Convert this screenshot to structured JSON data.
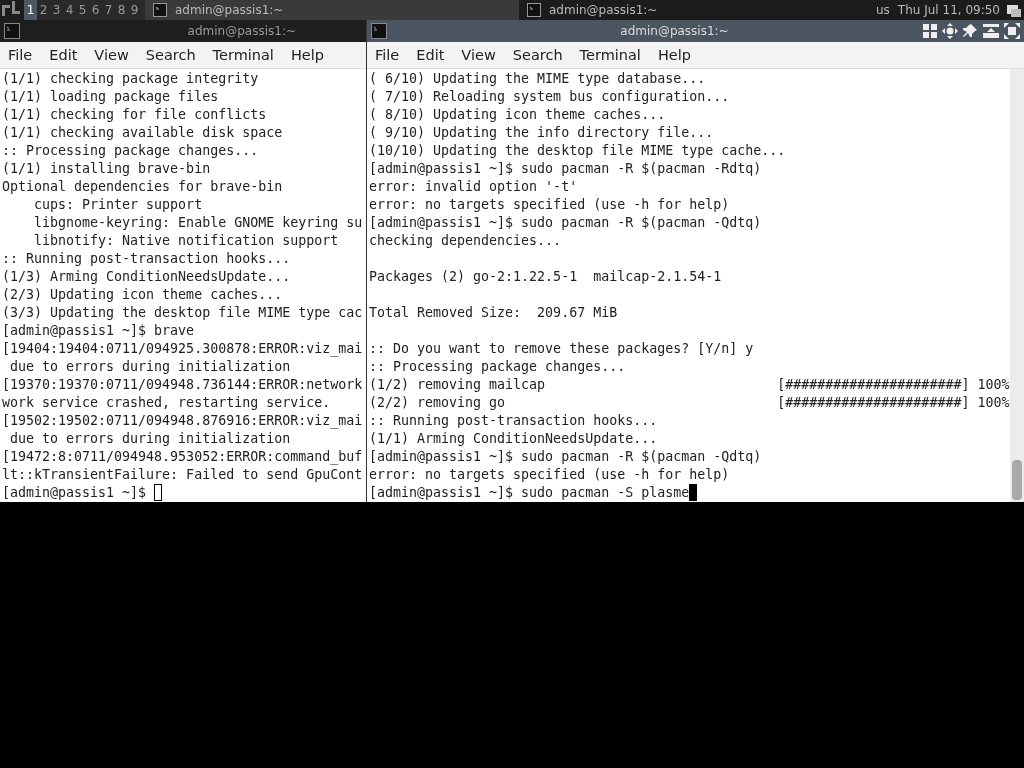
{
  "panel": {
    "workspaces": [
      {
        "label": "1",
        "selected": true
      },
      {
        "label": "2",
        "selected": false
      },
      {
        "label": "3",
        "selected": false
      },
      {
        "label": "4",
        "selected": false
      },
      {
        "label": "5",
        "selected": false
      },
      {
        "label": "6",
        "selected": false
      },
      {
        "label": "7",
        "selected": false
      },
      {
        "label": "8",
        "selected": false
      },
      {
        "label": "9",
        "selected": false
      }
    ],
    "tasks": [
      {
        "title": "admin@passis1:~",
        "selected": true
      },
      {
        "title": "admin@passis1:~",
        "selected": false
      }
    ],
    "keyboard_layout": "us",
    "clock": "Thu Jul 11, 09:50"
  },
  "windows": [
    {
      "title": "admin@passis1:~",
      "focused": false,
      "scrollbar": false,
      "menu": [
        "File",
        "Edit",
        "View",
        "Search",
        "Terminal",
        "Help"
      ],
      "blocks": [
        [
          "(1/1) checking package integrity",
          "(1/1) loading package files",
          "(1/1) checking for file conflicts",
          "(1/1) checking available disk space",
          ":: Processing package changes...",
          "(1/1) installing brave-bin",
          "Optional dependencies for brave-bin",
          "    cups: Printer support",
          "    libgnome-keyring: Enable GNOME keyring su",
          "    libnotify: Native notification support",
          ":: Running post-transaction hooks...",
          "(1/3) Arming ConditionNeedsUpdate...",
          "(2/3) Updating icon theme caches...",
          "(3/3) Updating the desktop file MIME type cac",
          "[admin@passis1 ~]$ brave",
          "[19404:19404:0711/094925.300878:ERROR:viz_mai",
          " due to errors during initialization",
          "[19370:19370:0711/094948.736144:ERROR:network",
          "work service crashed, restarting service.",
          "[19502:19502:0711/094948.876916:ERROR:viz_mai",
          " due to errors during initialization",
          "[19472:8:0711/094948.953052:ERROR:command_buf",
          "lt::kTransientFailure: Failed to send GpuCont",
          "[admin@passis1 ~]$ "
        ]
      ]
    },
    {
      "title": "admin@passis1:~",
      "focused": true,
      "scrollbar": true,
      "menu": [
        "File",
        "Edit",
        "View",
        "Search",
        "Terminal",
        "Help"
      ],
      "blocks": [
        [
          "( 6/10) Updating the MIME type database...",
          "( 7/10) Reloading system bus configuration...",
          "( 8/10) Updating icon theme caches...",
          "( 9/10) Updating the info directory file...",
          "(10/10) Updating the desktop file MIME type cache...",
          "[admin@passis1 ~]$ sudo pacman -R $(pacman -Rdtq)",
          "error: invalid option '-t'",
          "error: no targets specified (use -h for help)",
          "[admin@passis1 ~]$ sudo pacman -R $(pacman -Qdtq)",
          "checking dependencies..."
        ],
        [
          "Packages (2) go-2:1.22.5-1  mailcap-2.1.54-1"
        ],
        [
          "Total Removed Size:  209.67 MiB"
        ],
        [
          ":: Do you want to remove these packages? [Y/n] y",
          ":: Processing package changes...",
          "(1/2) removing mailcap                             [######################] 100%",
          "(2/2) removing go                                  [######################] 100%",
          ":: Running post-transaction hooks...",
          "(1/1) Arming ConditionNeedsUpdate...",
          "[admin@passis1 ~]$ sudo pacman -R $(pacman -Qdtq)",
          "error: no targets specified (use -h for help)",
          "[admin@passis1 ~]$ sudo pacman -S plasme"
        ]
      ]
    }
  ]
}
